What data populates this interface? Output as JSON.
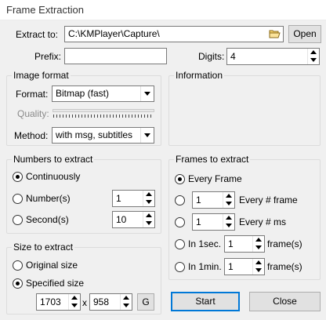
{
  "window": {
    "title": "Frame Extraction"
  },
  "extract_to": {
    "label": "Extract to:",
    "value": "C:\\KMPlayer\\Capture\\",
    "open_label": "Open"
  },
  "prefix": {
    "label": "Prefix:",
    "value": ""
  },
  "digits": {
    "label": "Digits:",
    "value": "4"
  },
  "image_format": {
    "title": "Image format",
    "format_label": "Format:",
    "format_value": "Bitmap (fast)",
    "quality_label": "Quality:",
    "method_label": "Method:",
    "method_value": "with msg, subtitles"
  },
  "information": {
    "title": "Information"
  },
  "numbers_to_extract": {
    "title": "Numbers to extract",
    "continuously": "Continuously",
    "numbers": "Number(s)",
    "numbers_value": "1",
    "seconds": "Second(s)",
    "seconds_value": "10"
  },
  "frames_to_extract": {
    "title": "Frames to extract",
    "every_frame": "Every Frame",
    "every_n_frame_value": "1",
    "every_n_frame_label": "Every # frame",
    "every_n_ms_value": "1",
    "every_n_ms_label": "Every # ms",
    "in_1sec_label": "In 1sec.",
    "in_1sec_value": "1",
    "in_1sec_unit": "frame(s)",
    "in_1min_label": "In 1min.",
    "in_1min_value": "1",
    "in_1min_unit": "frame(s)"
  },
  "size_to_extract": {
    "title": "Size to extract",
    "original": "Original size",
    "specified": "Specified size",
    "width": "1703",
    "separator": "x",
    "height": "958",
    "g_label": "G"
  },
  "actions": {
    "start": "Start",
    "close": "Close"
  }
}
